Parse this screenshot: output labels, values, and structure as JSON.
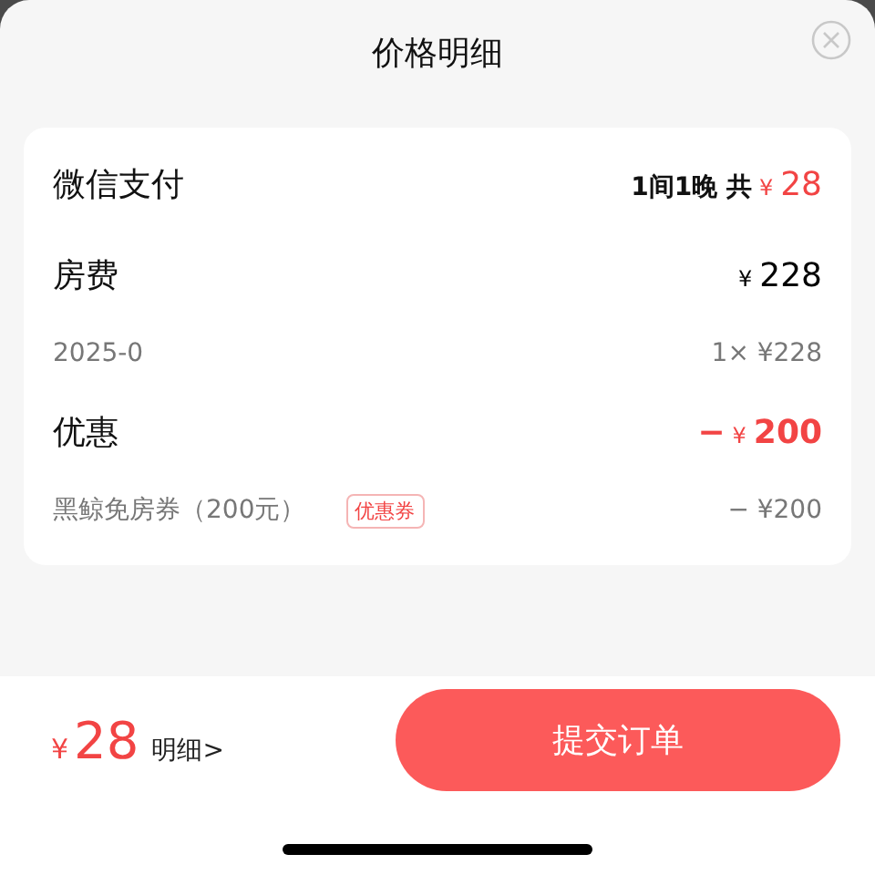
{
  "sheet": {
    "title": "价格明细"
  },
  "payment": {
    "method": "微信支付",
    "summary": "1间1晚 共",
    "currency": "¥",
    "total": "28"
  },
  "sections": [
    {
      "label": "房费",
      "currency": "¥",
      "amount": "228",
      "highlight": false,
      "detail": {
        "label": "2025-0",
        "value": "1× ¥228"
      }
    },
    {
      "label": "优惠",
      "amount_sign": "−",
      "currency": "¥",
      "amount": "200",
      "highlight": true,
      "detail": {
        "label": "黑鲸免房券（200元）",
        "tag": "优惠券",
        "value": "− ¥200"
      }
    }
  ],
  "footer": {
    "currency": "¥",
    "total": "28",
    "details_link": "明细>",
    "submit_button": "提交订单"
  }
}
